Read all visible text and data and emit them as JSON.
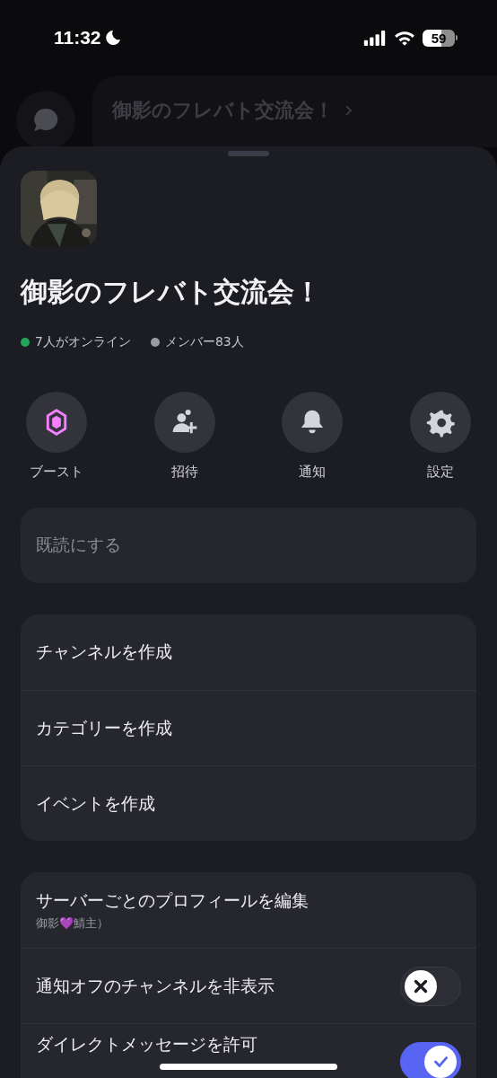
{
  "status_bar": {
    "time": "11:32",
    "battery": "59"
  },
  "background": {
    "server_title": "御影のフレバト交流会！"
  },
  "sheet": {
    "avatar": {
      "kind": "picture"
    },
    "server_name": "御影のフレバト交流会！",
    "stats": [
      {
        "text": "7人がオンライン",
        "color": "#23a55a"
      },
      {
        "text": "メンバー83人",
        "color": "#9a9ba3"
      }
    ],
    "actions": [
      {
        "label": "ブースト"
      },
      {
        "label": "招待"
      },
      {
        "label": "通知"
      },
      {
        "label": "設定"
      }
    ],
    "groups": [
      [
        {
          "kind": "link",
          "label": "既読にする",
          "disabled": true
        }
      ],
      [
        {
          "kind": "link",
          "label": "チャンネルを作成",
          "disabled": false
        },
        {
          "kind": "link",
          "label": "カテゴリーを作成",
          "disabled": false
        },
        {
          "kind": "link",
          "label": "イベントを作成",
          "disabled": false
        }
      ],
      [
        {
          "kind": "link",
          "label": "サーバーごとのプロフィールを編集",
          "subtitle": "御影💜鯖主）",
          "disabled": false
        },
        {
          "kind": "toggle",
          "label": "通知オフのチャンネルを非表示",
          "on": false
        },
        {
          "kind": "toggle",
          "label": "ダイレクトメッセージを許可",
          "on": true
        }
      ]
    ]
  }
}
